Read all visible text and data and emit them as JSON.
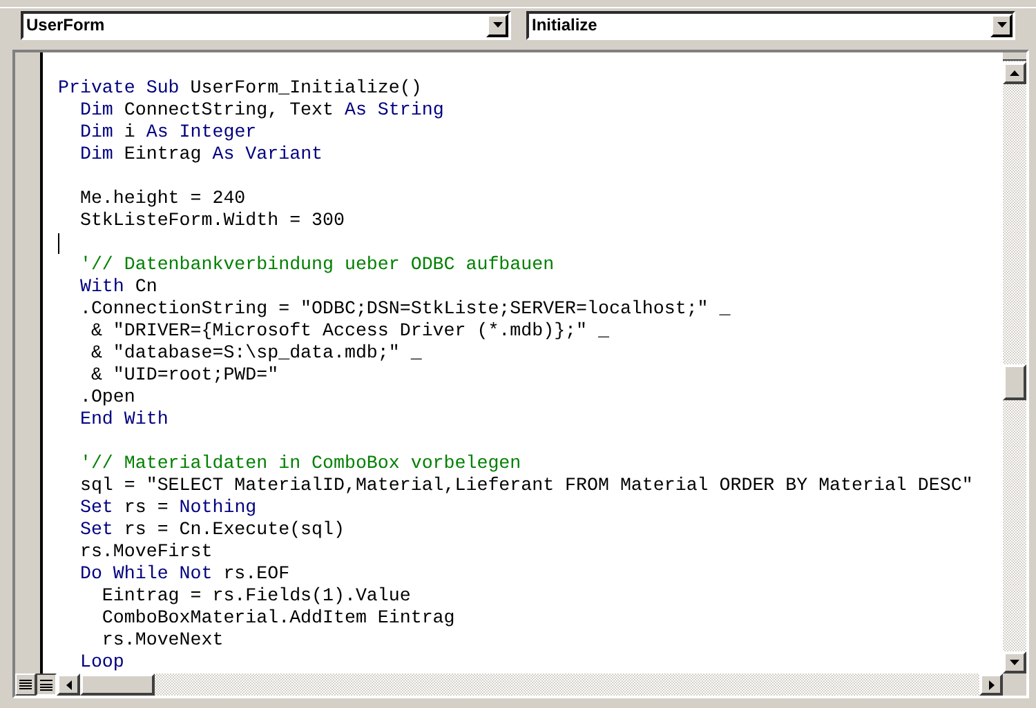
{
  "toolbar": {
    "object_combo": {
      "value": "UserForm"
    },
    "procedure_combo": {
      "value": "Initialize"
    }
  },
  "code_lines": [
    {
      "kind": "code",
      "segments": [
        {
          "kind": "keyword",
          "text": "Private Sub "
        },
        {
          "kind": "plain",
          "text": "UserForm_Initialize()"
        }
      ]
    },
    {
      "kind": "code",
      "segments": [
        {
          "kind": "keyword",
          "text": "  Dim "
        },
        {
          "kind": "plain",
          "text": "ConnectString, Text "
        },
        {
          "kind": "keyword",
          "text": "As String"
        }
      ]
    },
    {
      "kind": "code",
      "segments": [
        {
          "kind": "keyword",
          "text": "  Dim "
        },
        {
          "kind": "plain",
          "text": "i "
        },
        {
          "kind": "keyword",
          "text": "As Integer"
        }
      ]
    },
    {
      "kind": "code",
      "segments": [
        {
          "kind": "keyword",
          "text": "  Dim "
        },
        {
          "kind": "plain",
          "text": "Eintrag "
        },
        {
          "kind": "keyword",
          "text": "As Variant"
        }
      ]
    },
    {
      "kind": "blank"
    },
    {
      "kind": "code",
      "segments": [
        {
          "kind": "plain",
          "text": "  Me.height = 240"
        }
      ]
    },
    {
      "kind": "code",
      "segments": [
        {
          "kind": "plain",
          "text": "  StkListeForm.Width = 300"
        }
      ]
    },
    {
      "kind": "cursor"
    },
    {
      "kind": "code",
      "segments": [
        {
          "kind": "comment",
          "text": "  '// Datenbankverbindung ueber ODBC aufbauen"
        }
      ]
    },
    {
      "kind": "code",
      "segments": [
        {
          "kind": "keyword",
          "text": "  With "
        },
        {
          "kind": "plain",
          "text": "Cn"
        }
      ]
    },
    {
      "kind": "code",
      "segments": [
        {
          "kind": "plain",
          "text": "  .ConnectionString = \"ODBC;DSN=StkListe;SERVER=localhost;\" _"
        }
      ]
    },
    {
      "kind": "code",
      "segments": [
        {
          "kind": "plain",
          "text": "   & \"DRIVER={Microsoft Access Driver (*.mdb)};\" _"
        }
      ]
    },
    {
      "kind": "code",
      "segments": [
        {
          "kind": "plain",
          "text": "   & \"database=S:\\sp_data.mdb;\" _"
        }
      ]
    },
    {
      "kind": "code",
      "segments": [
        {
          "kind": "plain",
          "text": "   & \"UID=root;PWD=\""
        }
      ]
    },
    {
      "kind": "code",
      "segments": [
        {
          "kind": "plain",
          "text": "  .Open"
        }
      ]
    },
    {
      "kind": "code",
      "segments": [
        {
          "kind": "keyword",
          "text": "  End With"
        }
      ]
    },
    {
      "kind": "blank"
    },
    {
      "kind": "code",
      "segments": [
        {
          "kind": "comment",
          "text": "  '// Materialdaten in ComboBox vorbelegen"
        }
      ]
    },
    {
      "kind": "code",
      "segments": [
        {
          "kind": "plain",
          "text": "  sql = \"SELECT MaterialID,Material,Lieferant FROM Material ORDER BY Material DESC\""
        }
      ]
    },
    {
      "kind": "code",
      "segments": [
        {
          "kind": "keyword",
          "text": "  Set "
        },
        {
          "kind": "plain",
          "text": "rs = "
        },
        {
          "kind": "keyword",
          "text": "Nothing"
        }
      ]
    },
    {
      "kind": "code",
      "segments": [
        {
          "kind": "keyword",
          "text": "  Set "
        },
        {
          "kind": "plain",
          "text": "rs = Cn.Execute(sql)"
        }
      ]
    },
    {
      "kind": "code",
      "segments": [
        {
          "kind": "plain",
          "text": "  rs.MoveFirst"
        }
      ]
    },
    {
      "kind": "code",
      "segments": [
        {
          "kind": "keyword",
          "text": "  Do While Not "
        },
        {
          "kind": "plain",
          "text": "rs.EOF"
        }
      ]
    },
    {
      "kind": "code",
      "segments": [
        {
          "kind": "plain",
          "text": "    Eintrag = rs.Fields(1).Value"
        }
      ]
    },
    {
      "kind": "code",
      "segments": [
        {
          "kind": "plain",
          "text": "    ComboBoxMaterial.AddItem Eintrag"
        }
      ]
    },
    {
      "kind": "code",
      "segments": [
        {
          "kind": "plain",
          "text": "    rs.MoveNext"
        }
      ]
    },
    {
      "kind": "code",
      "segments": [
        {
          "kind": "keyword",
          "text": "  Loop"
        }
      ]
    }
  ]
}
